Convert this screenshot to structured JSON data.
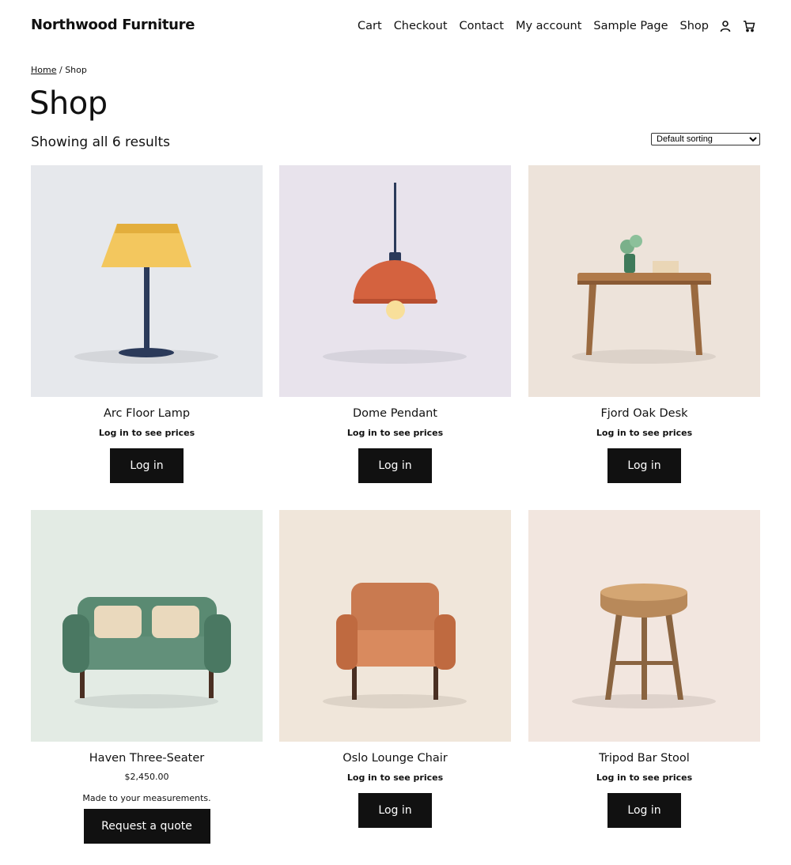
{
  "site": {
    "title": "Northwood Furniture"
  },
  "nav": {
    "items": [
      {
        "label": "Cart"
      },
      {
        "label": "Checkout"
      },
      {
        "label": "Contact"
      },
      {
        "label": "My account"
      },
      {
        "label": "Sample Page"
      },
      {
        "label": "Shop"
      }
    ],
    "icons": [
      "account-icon",
      "cart-icon"
    ]
  },
  "breadcrumb": {
    "home": "Home",
    "separator": " / ",
    "current": "Shop"
  },
  "page": {
    "title": "Shop",
    "result_count": "Showing all 6 results"
  },
  "sorting": {
    "selected": "Default sorting"
  },
  "products": [
    {
      "name": "Arc Floor Lamp",
      "price_note": "Log in to see prices",
      "button": "Log in",
      "bg": "#e6e8ec"
    },
    {
      "name": "Dome Pendant",
      "price_note": "Log in to see prices",
      "button": "Log in",
      "bg": "#e8e3ec"
    },
    {
      "name": "Fjord Oak Desk",
      "price_note": "Log in to see prices",
      "button": "Log in",
      "bg": "#ede3da"
    },
    {
      "name": "Haven Three-Seater",
      "price": "$2,450.00",
      "description": "Made to your measurements.",
      "button": "Request a quote",
      "bg": "#e3ebe4"
    },
    {
      "name": "Oslo Lounge Chair",
      "price_note": "Log in to see prices",
      "button": "Log in",
      "bg": "#f0e6da"
    },
    {
      "name": "Tripod Bar Stool",
      "price_note": "Log in to see prices",
      "button": "Log in",
      "bg": "#f2e6df"
    }
  ]
}
